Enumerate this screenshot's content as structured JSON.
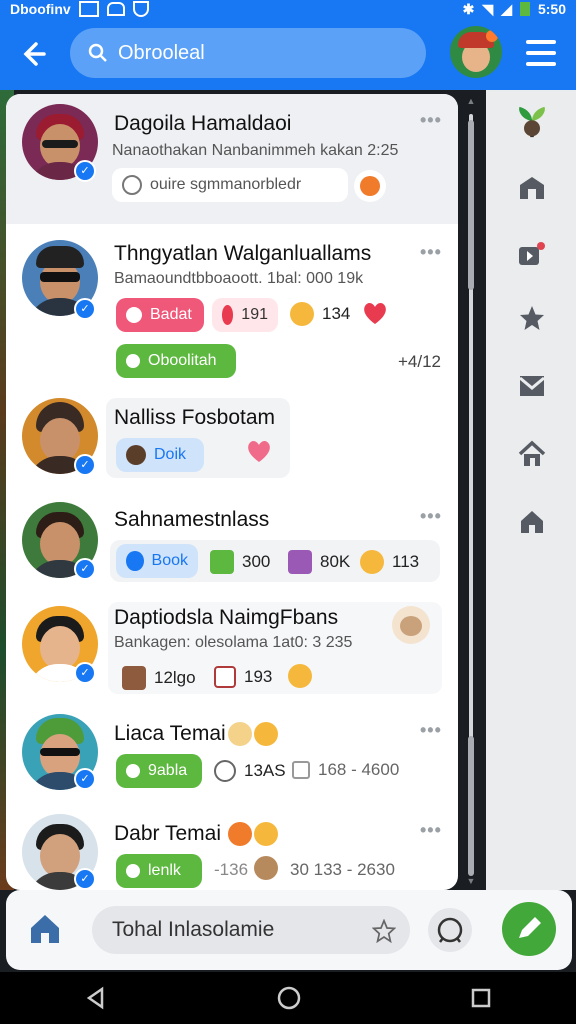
{
  "status_bar": {
    "left": "Dboofinv",
    "right": "5:50"
  },
  "app_bar": {
    "search_placeholder": "Obrooleal"
  },
  "featured": {
    "title": "Dagoila Hamaldaoi",
    "subtitle": "Nanaothakan Nanbanimmeh kakan 2:25",
    "chip_text": "ouire sgmmanorbledr"
  },
  "posts": [
    {
      "name": "Thngyatlan Walganluallams",
      "sub": "Bamaoundtbboaoott. 1bal: 000 19k",
      "pill1": "Badat",
      "stat1": "191",
      "stat2": "134",
      "action": "Oboolitah",
      "time": "+4/12"
    },
    {
      "name": "Nalliss Fosbotam",
      "pill1": "Doik"
    },
    {
      "name": "Sahnamestnlass",
      "pill1": "Book",
      "stat1": "300",
      "stat2": "80K",
      "stat3": "113"
    },
    {
      "name": "Daptiodsla NaimgFbans",
      "sub": "Bankagen: olesolama 1at0: 3 235",
      "stat1": "12lgo",
      "stat2": "193"
    },
    {
      "name": "Liaca Temai",
      "pill1": "9abla",
      "stat1": "13AS",
      "stat2": "168 - 4600"
    },
    {
      "name": "Dabr Temai",
      "pill1": "lenlk",
      "stat1": "-136",
      "stat2": "30 133 - 2630"
    }
  ],
  "bottom": {
    "compose_placeholder": "Tohal Inlasolamie"
  },
  "colors": {
    "brand": "#1877f2",
    "green": "#5cb83e",
    "pink": "#f0587a"
  }
}
